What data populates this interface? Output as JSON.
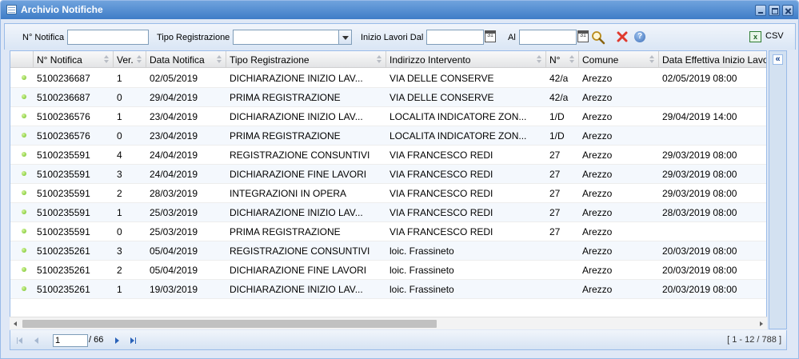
{
  "window": {
    "title": "Archivio Notifiche"
  },
  "filters": {
    "n_notifica_label": "N° Notifica",
    "n_notifica_value": "",
    "tipo_registrazione_label": "Tipo Registrazione",
    "tipo_registrazione_value": "",
    "inizio_lavori_dal_label": "Inizio Lavori Dal",
    "inizio_lavori_dal_value": "",
    "al_label": "Al",
    "al_value": "",
    "csv_label": "CSV",
    "help_glyph": "?",
    "calendar_glyph": "31"
  },
  "grid": {
    "columns": [
      "N° Notifica",
      "Ver.",
      "Data Notifica",
      "Tipo Registrazione",
      "Indirizzo Intervento",
      "N°",
      "Comune",
      "Data Effettiva Inizio Lavori"
    ],
    "rows": [
      [
        "5100236687",
        "1",
        "02/05/2019",
        "DICHIARAZIONE INIZIO LAV...",
        "VIA DELLE CONSERVE",
        "42/a",
        "Arezzo",
        "02/05/2019 08:00"
      ],
      [
        "5100236687",
        "0",
        "29/04/2019",
        "PRIMA REGISTRAZIONE",
        "VIA DELLE CONSERVE",
        "42/a",
        "Arezzo",
        ""
      ],
      [
        "5100236576",
        "1",
        "23/04/2019",
        "DICHIARAZIONE INIZIO LAV...",
        "LOCALITA INDICATORE ZON...",
        "1/D",
        "Arezzo",
        "29/04/2019 14:00"
      ],
      [
        "5100236576",
        "0",
        "23/04/2019",
        "PRIMA REGISTRAZIONE",
        "LOCALITA INDICATORE ZON...",
        "1/D",
        "Arezzo",
        ""
      ],
      [
        "5100235591",
        "4",
        "24/04/2019",
        "REGISTRAZIONE CONSUNTIVI",
        "VIA FRANCESCO REDI",
        "27",
        "Arezzo",
        "29/03/2019 08:00"
      ],
      [
        "5100235591",
        "3",
        "24/04/2019",
        "DICHIARAZIONE FINE LAVORI",
        "VIA FRANCESCO REDI",
        "27",
        "Arezzo",
        "29/03/2019 08:00"
      ],
      [
        "5100235591",
        "2",
        "28/03/2019",
        "INTEGRAZIONI IN OPERA",
        "VIA FRANCESCO REDI",
        "27",
        "Arezzo",
        "29/03/2019 08:00"
      ],
      [
        "5100235591",
        "1",
        "25/03/2019",
        "DICHIARAZIONE INIZIO LAV...",
        "VIA FRANCESCO REDI",
        "27",
        "Arezzo",
        "28/03/2019 08:00"
      ],
      [
        "5100235591",
        "0",
        "25/03/2019",
        "PRIMA REGISTRAZIONE",
        "VIA FRANCESCO REDI",
        "27",
        "Arezzo",
        ""
      ],
      [
        "5100235261",
        "3",
        "05/04/2019",
        "REGISTRAZIONE CONSUNTIVI",
        "loic. Frassineto",
        "",
        "Arezzo",
        "20/03/2019 08:00"
      ],
      [
        "5100235261",
        "2",
        "05/04/2019",
        "DICHIARAZIONE FINE LAVORI",
        "loic. Frassineto",
        "",
        "Arezzo",
        "20/03/2019 08:00"
      ],
      [
        "5100235261",
        "1",
        "19/03/2019",
        "DICHIARAZIONE INIZIO LAV...",
        "loic. Frassineto",
        "",
        "Arezzo",
        "20/03/2019 08:00"
      ]
    ],
    "row_status_color": "#6cbf1e"
  },
  "side_panel": {
    "expand_glyph": "«"
  },
  "paging": {
    "current_page": "1",
    "total_pages_text": "/ 66",
    "info": "[ 1 - 12 / 788 ]"
  },
  "colors": {
    "titlebar": "#4a86cf",
    "border": "#99bbe8",
    "panel_bg": "#dfe8f6"
  }
}
